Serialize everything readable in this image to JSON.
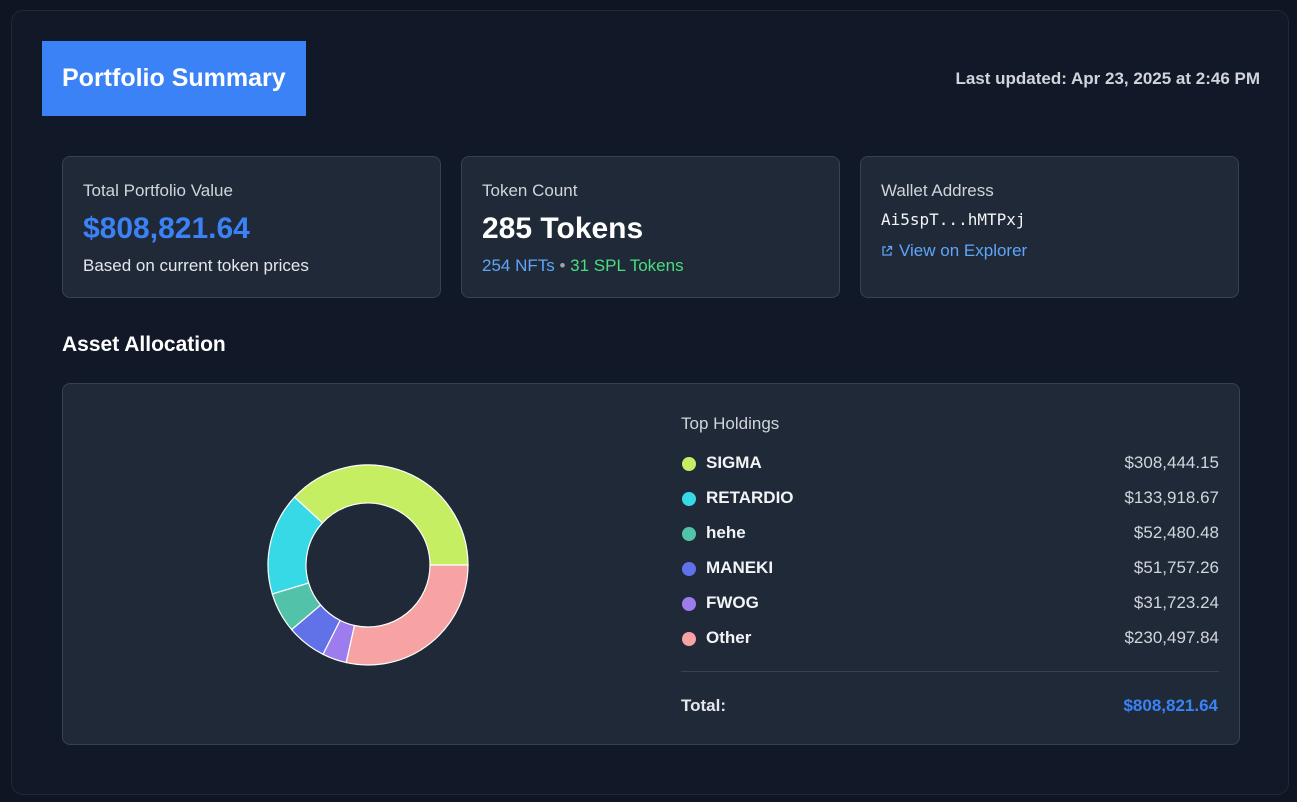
{
  "header": {
    "title": "Portfolio Summary",
    "last_updated": "Last updated: Apr 23, 2025 at 2:46 PM"
  },
  "cards": {
    "portfolio": {
      "label": "Total Portfolio Value",
      "value": "$808,821.64",
      "sub": "Based on current token prices"
    },
    "token_count": {
      "label": "Token Count",
      "value": "285 Tokens",
      "nfts": "254 NFTs",
      "separator": "•",
      "spl": "31 SPL Tokens"
    },
    "wallet": {
      "label": "Wallet Address",
      "address": "Ai5spT...hMTPxj",
      "explorer_link": "View on Explorer",
      "explorer_icon": "external-link-icon"
    }
  },
  "allocation": {
    "section_title": "Asset Allocation",
    "holdings_title": "Top Holdings",
    "total_label": "Total:",
    "total_value": "$808,821.64",
    "holdings": [
      {
        "name": "SIGMA",
        "value": "$308,444.15",
        "color": "#c5ee63"
      },
      {
        "name": "RETARDIO",
        "value": "$133,918.67",
        "color": "#38d9e6"
      },
      {
        "name": "hehe",
        "value": "$52,480.48",
        "color": "#52c3a8"
      },
      {
        "name": "MANEKI",
        "value": "$51,757.26",
        "color": "#6172e9"
      },
      {
        "name": "FWOG",
        "value": "$31,723.24",
        "color": "#9d7cee"
      },
      {
        "name": "Other",
        "value": "$230,497.84",
        "color": "#f7a3a4"
      }
    ]
  },
  "chart_data": {
    "type": "pie",
    "categories": [
      "SIGMA",
      "RETARDIO",
      "hehe",
      "MANEKI",
      "FWOG",
      "Other"
    ],
    "values": [
      308444.15,
      133918.67,
      52480.48,
      51757.26,
      31723.24,
      230497.84
    ],
    "colors": [
      "#c5ee63",
      "#38d9e6",
      "#52c3a8",
      "#6172e9",
      "#9d7cee",
      "#f7a3a4"
    ]
  }
}
